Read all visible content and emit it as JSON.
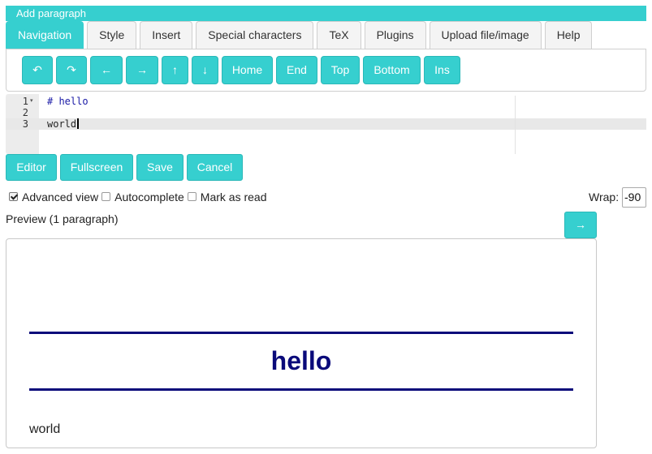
{
  "title_bar": "Add paragraph",
  "tabs": [
    {
      "label": "Navigation",
      "active": true
    },
    {
      "label": "Style",
      "active": false
    },
    {
      "label": "Insert",
      "active": false
    },
    {
      "label": "Special characters",
      "active": false
    },
    {
      "label": "TeX",
      "active": false
    },
    {
      "label": "Plugins",
      "active": false
    },
    {
      "label": "Upload file/image",
      "active": false
    },
    {
      "label": "Help",
      "active": false
    }
  ],
  "toolbar": {
    "undo": "↶",
    "redo": "↷",
    "left": "←",
    "right": "→",
    "up": "↑",
    "down": "↓",
    "home": "Home",
    "end": "End",
    "top": "Top",
    "bottom": "Bottom",
    "ins": "Ins"
  },
  "editor": {
    "lines": [
      {
        "number": "1",
        "text": "# hello"
      },
      {
        "number": "2",
        "text": ""
      },
      {
        "number": "3",
        "text": "world"
      }
    ],
    "fold_marker": "▾"
  },
  "editor_buttons": {
    "editor": "Editor",
    "fullscreen": "Fullscreen",
    "save": "Save",
    "cancel": "Cancel"
  },
  "options": {
    "advanced_view": {
      "label": "Advanced view",
      "checked": true
    },
    "autocomplete": {
      "label": "Autocomplete",
      "checked": false
    },
    "mark_as_read": {
      "label": "Mark as read",
      "checked": false
    }
  },
  "wrap": {
    "label": "Wrap:",
    "value": "-90"
  },
  "preview": {
    "label": "Preview (1 paragraph)",
    "next_button": "→",
    "heading": "hello",
    "paragraph": "world"
  },
  "colors": {
    "accent": "#36cfcf",
    "heading": "#0a0a7a"
  }
}
